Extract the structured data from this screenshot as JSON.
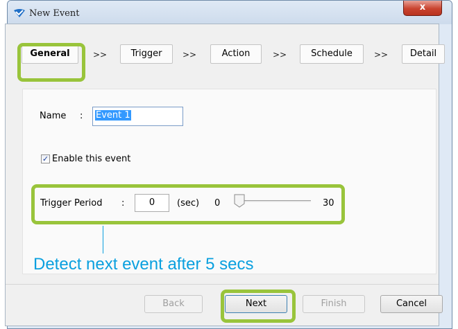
{
  "window": {
    "title": "New Event",
    "close_glyph": "x",
    "app_icon": "vivotek-check-icon"
  },
  "tabs": [
    {
      "label": "General",
      "active": true
    },
    {
      "label": "Trigger",
      "active": false
    },
    {
      "label": "Action",
      "active": false
    },
    {
      "label": "Schedule",
      "active": false
    },
    {
      "label": "Detail",
      "active": false
    }
  ],
  "tab_separator": ">>",
  "general": {
    "name_label": "Name",
    "name_colon": ":",
    "name_value": "Event 1",
    "enable_label": "Enable this event",
    "enable_checked": true,
    "trigger_period_label": "Trigger Period",
    "trigger_period_colon": ":",
    "trigger_period_value": "0",
    "unit": "(sec)",
    "slider_min": "0",
    "slider_max": "30",
    "slider_value": 0
  },
  "annotation": {
    "callout": "Detect next event after 5 secs",
    "highlight_color": "#99c43b",
    "callout_color": "#0aa0df"
  },
  "buttons": {
    "back": "Back",
    "next": "Next",
    "finish": "Finish",
    "cancel": "Cancel"
  }
}
